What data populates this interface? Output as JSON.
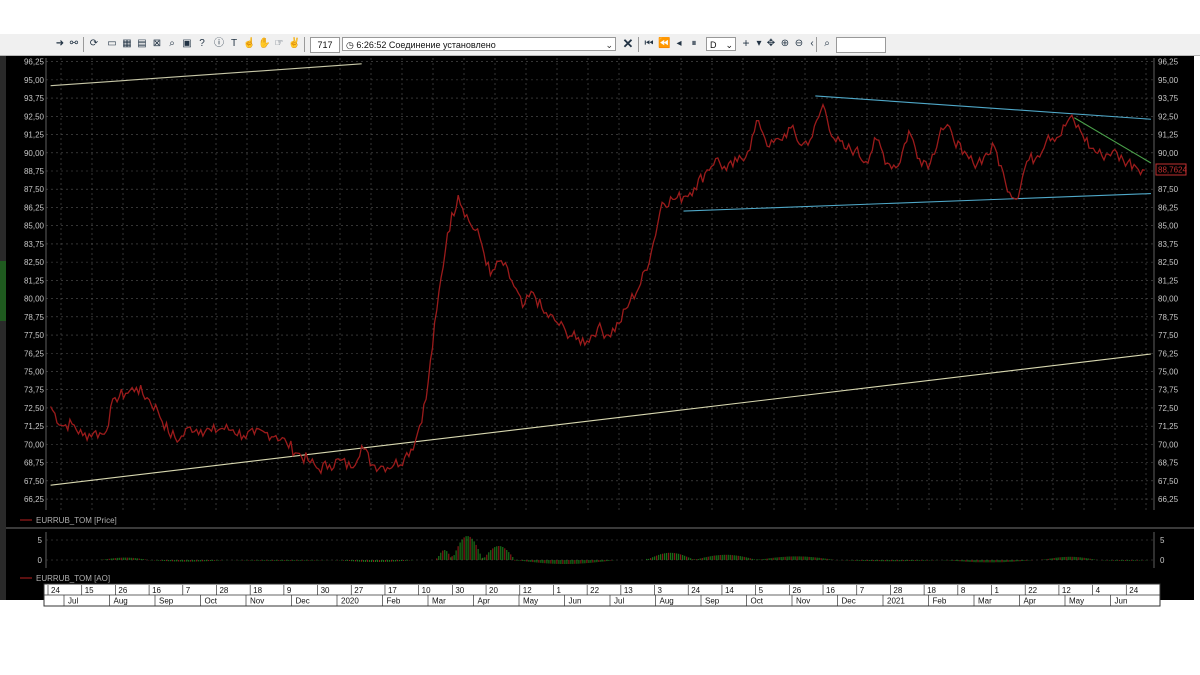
{
  "toolbar": {
    "count": "717",
    "time": "6:26:52",
    "status_text": "Соединение установлено",
    "period": "D",
    "search_value": ""
  },
  "colors": {
    "background": "#000000",
    "price_line": "#9b1b1b",
    "trend_line_lower": "#d8d8b0",
    "trend_line_upper": "#c8c8a8",
    "triangle_lines": "#4fa8c8",
    "short_trend": "#4aa04a",
    "ao_up": "#1f8a1f",
    "ao_down": "#a02020",
    "grid": "#555555"
  },
  "chart_data": [
    {
      "type": "line",
      "legend": "EURRUB_TOM [Price]",
      "current_value_label": "88,7624",
      "ylim": [
        65.5,
        96.5
      ],
      "y_ticks": [
        "96,25",
        "95,00",
        "93,75",
        "92,50",
        "91,25",
        "90,00",
        "88,75",
        "87,50",
        "86,25",
        "85,00",
        "83,75",
        "82,50",
        "81,25",
        "80,00",
        "78,75",
        "77,50",
        "76,25",
        "75,00",
        "73,75",
        "72,50",
        "71,25",
        "70,00",
        "68,75",
        "67,50",
        "66,25"
      ],
      "x": [
        "2019-06-17",
        "2019-06-24",
        "2019-07-01",
        "2019-07-08",
        "2019-07-15",
        "2019-07-22",
        "2019-07-29",
        "2019-08-05",
        "2019-08-12",
        "2019-08-19",
        "2019-08-26",
        "2019-09-02",
        "2019-09-09",
        "2019-09-16",
        "2019-09-23",
        "2019-09-30",
        "2019-10-07",
        "2019-10-14",
        "2019-10-21",
        "2019-10-28",
        "2019-11-04",
        "2019-11-11",
        "2019-11-18",
        "2019-11-25",
        "2019-12-02",
        "2019-12-09",
        "2019-12-16",
        "2019-12-23",
        "2019-12-30",
        "2020-01-06",
        "2020-01-13",
        "2020-01-20",
        "2020-01-27",
        "2020-02-03",
        "2020-02-10",
        "2020-02-17",
        "2020-02-24",
        "2020-03-02",
        "2020-03-09",
        "2020-03-16",
        "2020-03-23",
        "2020-03-30",
        "2020-04-06",
        "2020-04-13",
        "2020-04-20",
        "2020-04-27",
        "2020-05-04",
        "2020-05-11",
        "2020-05-18",
        "2020-05-25",
        "2020-06-01",
        "2020-06-08",
        "2020-06-15",
        "2020-06-22",
        "2020-06-29",
        "2020-07-06",
        "2020-07-13",
        "2020-07-20",
        "2020-07-27",
        "2020-08-03",
        "2020-08-10",
        "2020-08-17",
        "2020-08-24",
        "2020-08-31",
        "2020-09-07",
        "2020-09-14",
        "2020-09-21",
        "2020-09-28",
        "2020-10-05",
        "2020-10-12",
        "2020-10-19",
        "2020-10-26",
        "2020-11-02",
        "2020-11-09",
        "2020-11-16",
        "2020-11-23",
        "2020-11-30",
        "2020-12-07",
        "2020-12-14",
        "2020-12-21",
        "2020-12-28",
        "2021-01-04",
        "2021-01-11",
        "2021-01-18",
        "2021-01-25",
        "2021-02-01",
        "2021-02-08",
        "2021-02-15",
        "2021-02-22",
        "2021-03-01",
        "2021-03-08",
        "2021-03-15",
        "2021-03-22",
        "2021-03-29",
        "2021-04-05",
        "2021-04-12",
        "2021-04-19",
        "2021-04-26",
        "2021-05-03",
        "2021-05-10",
        "2021-05-17",
        "2021-05-24",
        "2021-05-31"
      ],
      "values": [
        72.6,
        71.3,
        71.4,
        70.6,
        70.8,
        70.7,
        73.2,
        73.5,
        73.9,
        73.2,
        72.3,
        70.8,
        70.3,
        71.2,
        71.0,
        70.9,
        71.1,
        71.0,
        70.6,
        70.7,
        70.8,
        70.6,
        70.1,
        69.4,
        68.9,
        68.3,
        68.6,
        68.9,
        68.4,
        69.9,
        68.6,
        68.5,
        68.6,
        69.1,
        70.2,
        73.1,
        79.2,
        84.5,
        87.1,
        85.3,
        84.2,
        81.6,
        82.6,
        81.2,
        79.4,
        80.4,
        79.0,
        78.5,
        77.8,
        77.2,
        77.1,
        78.0,
        77.5,
        78.3,
        79.8,
        81.0,
        83.2,
        86.6,
        86.8,
        87.0,
        87.6,
        88.6,
        89.6,
        88.8,
        89.4,
        90.1,
        92.2,
        90.4,
        90.9,
        91.7,
        90.5,
        91.1,
        93.3,
        91.0,
        90.3,
        90.2,
        89.4,
        90.9,
        89.3,
        89.1,
        91.5,
        89.6,
        89.3,
        91.7,
        91.4,
        89.9,
        89.3,
        89.7,
        90.4,
        88.0,
        86.8,
        89.4,
        89.8,
        91.2,
        91.1,
        92.4,
        91.5,
        90.3,
        89.8,
        90.1,
        89.5,
        89.2,
        88.8
      ],
      "overlays": [
        {
          "name": "lower-support-line",
          "from": [
            "2019-06-17",
            67.2
          ],
          "to": [
            "2021-06-04",
            76.2
          ]
        },
        {
          "name": "upper-support-line",
          "from": [
            "2019-06-17",
            94.6
          ],
          "to": [
            "2020-01-06",
            96.1
          ]
        },
        {
          "name": "triangle-upper-line",
          "from": [
            "2020-10-28",
            93.9
          ],
          "to": [
            "2021-06-04",
            92.3
          ]
        },
        {
          "name": "triangle-lower-line",
          "from": [
            "2020-08-03",
            86.0
          ],
          "to": [
            "2021-06-04",
            87.2
          ]
        },
        {
          "name": "short-down-line",
          "from": [
            "2021-04-15",
            92.4
          ],
          "to": [
            "2021-06-04",
            89.3
          ]
        }
      ],
      "x_axis": {
        "row1": [
          "24",
          "15",
          "26",
          "16",
          "7",
          "28",
          "18",
          "9",
          "30",
          "27",
          "17",
          "10",
          "30",
          "20",
          "12",
          "1",
          "22",
          "13",
          "3",
          "24",
          "14",
          "5",
          "26",
          "16",
          "7",
          "28",
          "18",
          "8",
          "1",
          "22",
          "12",
          "4",
          "24"
        ],
        "row2": [
          "Jul",
          "Aug",
          "Sep",
          "Oct",
          "Nov",
          "Dec",
          "2020",
          "Feb",
          "Mar",
          "Apr",
          "May",
          "Jun",
          "Jul",
          "Aug",
          "Sep",
          "Oct",
          "Nov",
          "Dec",
          "2021",
          "Feb",
          "Mar",
          "Apr",
          "May",
          "Jun"
        ]
      }
    },
    {
      "type": "bar",
      "legend": "EURRUB_TOM [AO]",
      "ylim": [
        -2,
        7
      ],
      "y_ticks": [
        "5",
        "0"
      ],
      "segments": [
        {
          "from": "2019-07-20",
          "to": "2019-08-20",
          "value": 0.6
        },
        {
          "from": "2019-08-20",
          "to": "2019-10-10",
          "value": -0.4
        },
        {
          "from": "2019-10-10",
          "to": "2019-12-20",
          "value": -0.2
        },
        {
          "from": "2019-12-20",
          "to": "2020-02-10",
          "value": -0.5
        },
        {
          "from": "2020-02-24",
          "to": "2020-03-05",
          "value": 2.5
        },
        {
          "from": "2020-03-05",
          "to": "2020-03-25",
          "value": 6.0
        },
        {
          "from": "2020-03-25",
          "to": "2020-04-15",
          "value": 3.5
        },
        {
          "from": "2020-04-15",
          "to": "2020-06-20",
          "value": -1.0
        },
        {
          "from": "2020-07-10",
          "to": "2020-08-10",
          "value": 1.8
        },
        {
          "from": "2020-08-10",
          "to": "2020-09-20",
          "value": 1.3
        },
        {
          "from": "2020-09-20",
          "to": "2020-11-10",
          "value": 0.9
        },
        {
          "from": "2020-11-10",
          "to": "2021-01-20",
          "value": -0.3
        },
        {
          "from": "2021-01-20",
          "to": "2021-03-20",
          "value": -0.6
        },
        {
          "from": "2021-03-25",
          "to": "2021-04-30",
          "value": 0.8
        },
        {
          "from": "2021-04-30",
          "to": "2021-06-04",
          "value": -0.2
        }
      ]
    }
  ]
}
